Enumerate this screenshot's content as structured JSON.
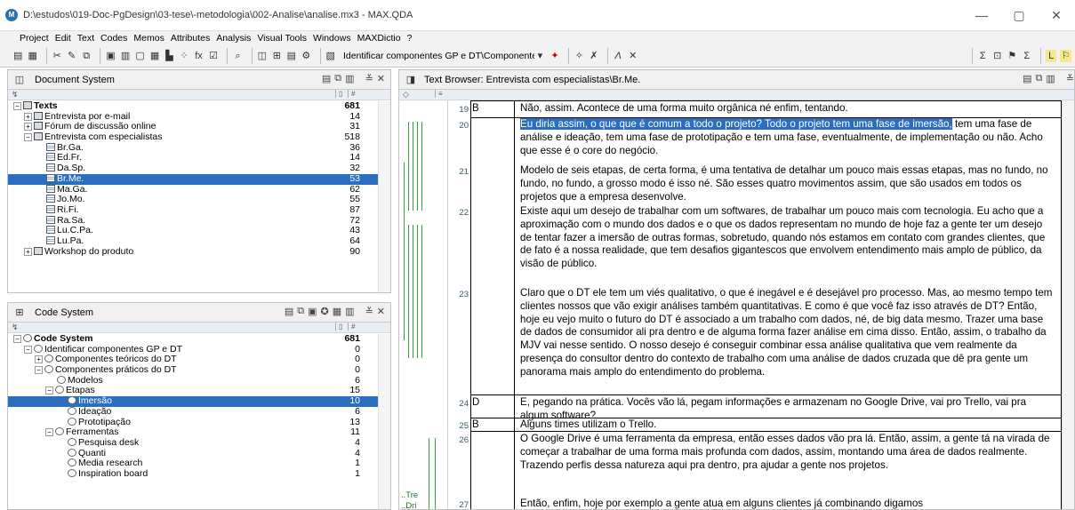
{
  "window": {
    "title": "D:\\estudos\\019-Doc-PgDesign\\03-tese\\-metodologia\\002-Analise\\analise.mx3 - MAX.QDA",
    "min": "—",
    "max": "▢",
    "close": "✕"
  },
  "menu": [
    "Project",
    "Edit",
    "Text",
    "Codes",
    "Memos",
    "Attributes",
    "Analysis",
    "Visual Tools",
    "Windows",
    "MAXDictio",
    "?"
  ],
  "toolbar": {
    "active_code": "Identificar componentes GP e DT\\Componentes pr..."
  },
  "document_system": {
    "title": "Document System",
    "rows": [
      {
        "label": "Texts",
        "count": "681",
        "level": 0,
        "kind": "root",
        "expand": "−"
      },
      {
        "label": "Entrevista por e-mail",
        "count": "14",
        "level": 1,
        "kind": "grp",
        "expand": "+"
      },
      {
        "label": "Fórum de discussão online",
        "count": "31",
        "level": 1,
        "kind": "grp",
        "expand": "+"
      },
      {
        "label": "Entrevista com especialistas",
        "count": "518",
        "level": 1,
        "kind": "grp",
        "expand": "−"
      },
      {
        "label": "Br.Ga.",
        "count": "36",
        "level": 2,
        "kind": "doc"
      },
      {
        "label": "Ed.Fr.",
        "count": "14",
        "level": 2,
        "kind": "doc"
      },
      {
        "label": "Da.Sp.",
        "count": "32",
        "level": 2,
        "kind": "doc"
      },
      {
        "label": "Br.Me.",
        "count": "53",
        "level": 2,
        "kind": "doc",
        "selected": true
      },
      {
        "label": "Ma.Ga.",
        "count": "62",
        "level": 2,
        "kind": "doc"
      },
      {
        "label": "Jo.Mo.",
        "count": "55",
        "level": 2,
        "kind": "doc"
      },
      {
        "label": "Ri.Fi.",
        "count": "87",
        "level": 2,
        "kind": "doc"
      },
      {
        "label": "Ra.Sa.",
        "count": "72",
        "level": 2,
        "kind": "doc"
      },
      {
        "label": "Lu.C.Pa.",
        "count": "43",
        "level": 2,
        "kind": "doc"
      },
      {
        "label": "Lu.Pa.",
        "count": "64",
        "level": 2,
        "kind": "doc"
      },
      {
        "label": "Workshop do produto",
        "count": "90",
        "level": 1,
        "kind": "grp",
        "expand": "+"
      }
    ]
  },
  "code_system": {
    "title": "Code System",
    "rows": [
      {
        "label": "Code System",
        "count": "681",
        "level": 0,
        "kind": "root",
        "expand": "−"
      },
      {
        "label": "Identificar componentes GP e DT",
        "count": "0",
        "level": 1,
        "expand": "−"
      },
      {
        "label": "Componentes teóricos do DT",
        "count": "0",
        "level": 2,
        "expand": "+"
      },
      {
        "label": "Componentes práticos do DT",
        "count": "0",
        "level": 2,
        "expand": "−"
      },
      {
        "label": "Modelos",
        "count": "6",
        "level": 3
      },
      {
        "label": "Etapas",
        "count": "15",
        "level": 3,
        "expand": "−"
      },
      {
        "label": "Imersão",
        "count": "10",
        "level": 4,
        "selected": true
      },
      {
        "label": "Ideação",
        "count": "6",
        "level": 4
      },
      {
        "label": "Prototipação",
        "count": "13",
        "level": 4
      },
      {
        "label": "Ferramentas",
        "count": "11",
        "level": 3,
        "expand": "−"
      },
      {
        "label": "Pesquisa desk",
        "count": "4",
        "level": 4
      },
      {
        "label": "Quanti",
        "count": "4",
        "level": 4
      },
      {
        "label": "Media research",
        "count": "1",
        "level": 4
      },
      {
        "label": "Inspiration board",
        "count": "1",
        "level": 4
      }
    ]
  },
  "browser": {
    "title": "Text Browser: Entrevista com especialistas\\Br.Me.",
    "gutter_labels": [
      "..Tre",
      "..Dri"
    ],
    "paragraphs": [
      {
        "num": "19",
        "speaker": "B",
        "text": "Não, assim. Acontece de uma forma muito orgânica né enfim, tentando."
      },
      {
        "num": "20",
        "speaker": "",
        "hl": "Eu diria assim, o que que é comum a todo o projeto? Todo o projeto tem uma fase de imersão,",
        "text": " tem uma fase de análise e ideação, tem uma fase de prototipação e tem uma fase, eventualmente, de implementação ou não. Acho que esse é o core do negócio."
      },
      {
        "num": "21",
        "speaker": "",
        "text": "Modelo de seis etapas, de certa forma, é uma tentativa de detalhar um pouco mais essas etapas, mas no fundo, no fundo, no fundo, a grosso modo é isso né. São esses quatro movimentos assim, que são usados em todos os projetos que a empresa desenvolve."
      },
      {
        "num": "22",
        "speaker": "",
        "text": "Existe aqui um desejo de trabalhar com um softwares, de trabalhar um pouco mais com tecnologia. Eu acho que a aproximação com o mundo dos dados e o que os dados representam no mundo de hoje faz a gente ter um desejo de tentar fazer a imersão de outras formas, sobretudo, quando nós estamos em contato com grandes clientes, que de fato é a nossa realidade, que tem desafios gigantescos que envolvem entendimento mais amplo de público, da visão de público."
      },
      {
        "num": "23",
        "speaker": "",
        "text": "Claro que o DT ele tem um viés qualitativo, o que é inegável e é desejável pro processo. Mas, ao mesmo tempo tem clientes nossos que vão exigir análises também quantitativas. E como é que você faz isso através de DT? Então, hoje eu vejo muito o futuro do DT é associado a um trabalho com dados, né, de big data mesmo. Trazer uma base de dados de consumidor ali pra dentro e de alguma forma fazer análise em cima disso. Então, assim, o trabalho da MJV vai nesse sentido. O nosso desejo é conseguir combinar essa análise qualitativa que vem realmente da presença do consultor dentro do contexto de trabalho com uma análise de dados cruzada que dê pra gente um panorama mais amplo do entendimento do problema."
      },
      {
        "num": "24",
        "speaker": "D",
        "text": "E, pegando na prática. Vocês vão lá, pegam informações e armazenam no Google Drive, vai pro Trello, vai pra algum software?"
      },
      {
        "num": "25",
        "speaker": "B",
        "text": "Alguns times utilizam o Trello."
      },
      {
        "num": "26",
        "speaker": "",
        "text": "O Google Drive é uma ferramenta da empresa, então esses dados vão pra lá. Então, assim, a gente tá na virada de começar a trabalhar de uma forma mais profunda com dados, assim, montando uma área de dados realmente. Trazendo perfis dessa natureza aqui pra dentro, pra ajudar a gente nos projetos."
      },
      {
        "num": "27",
        "speaker": "",
        "text": "Então, enfim, hoje por exemplo a gente atua em alguns clientes já combinando digamos"
      }
    ]
  }
}
